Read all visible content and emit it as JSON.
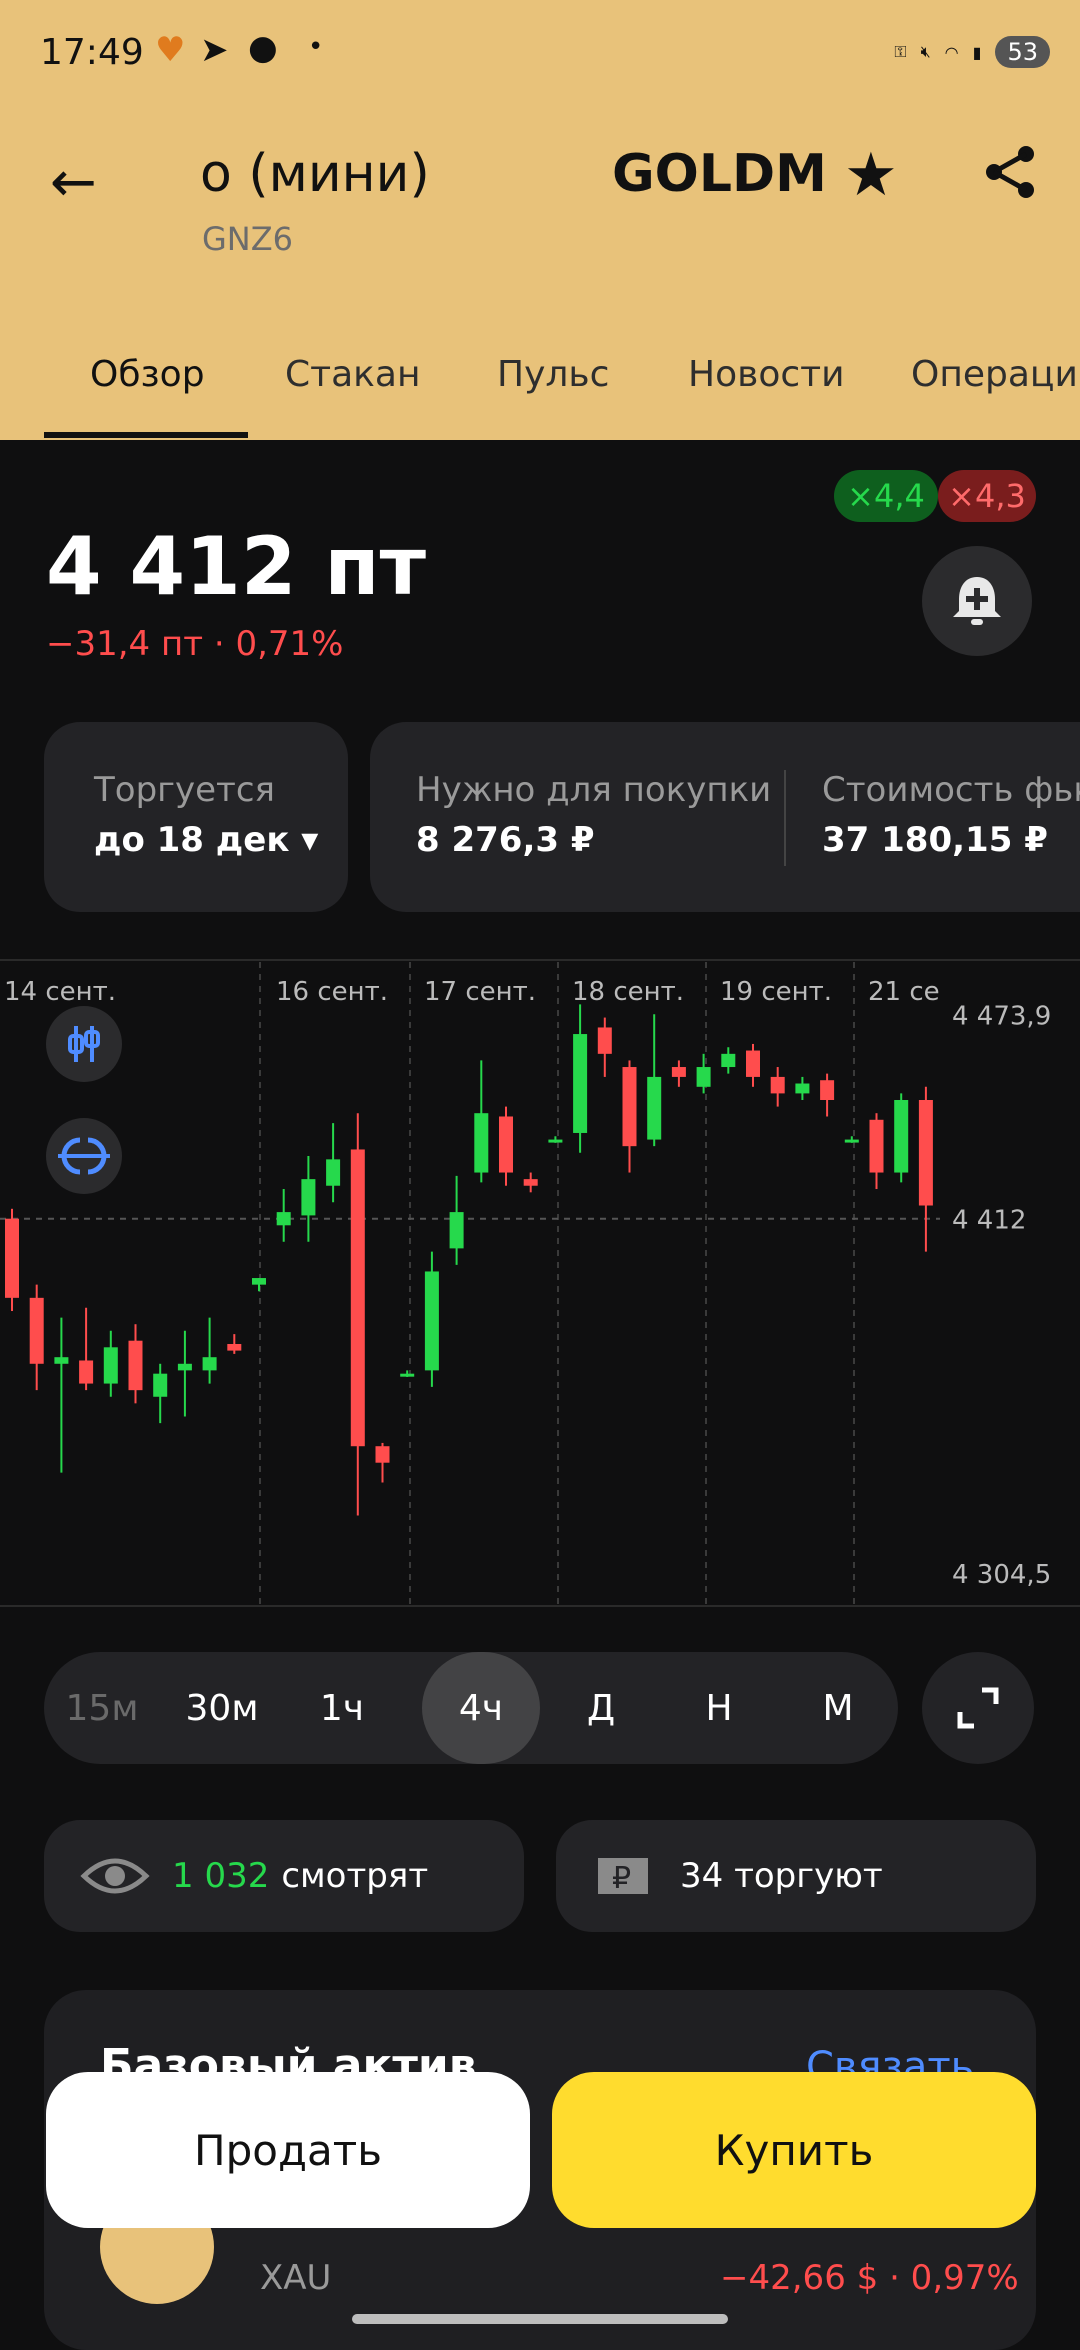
{
  "status": {
    "time": "17:49",
    "battery": "53",
    "signal": "5"
  },
  "header": {
    "title_left": "о (мини)",
    "subtitle": "GNZ6",
    "title_right": "GOLDM"
  },
  "tabs": [
    "Обзор",
    "Стакан",
    "Пульс",
    "Новости",
    "Операции"
  ],
  "leverage": {
    "long": "×4,4",
    "short": "×4,3"
  },
  "price": {
    "value": "4 412 пт",
    "change": "−31,4 пт · 0,71%"
  },
  "info": {
    "trading_label": "Торгуется",
    "trading_value": "до 18 дек ▾",
    "need_label": "Нужно для покупки",
    "need_value": "8 276,3 ₽",
    "cost_label": "Стоимость фьк",
    "cost_value": "37 180,15 ₽"
  },
  "chart_data": {
    "type": "candlestick",
    "x_labels": [
      "14 сент.",
      "16 сент.",
      "17 сент.",
      "18 сент.",
      "19 сент.",
      "21 се"
    ],
    "y_labels": [
      "4 473,9",
      "4 412",
      "4 304,5"
    ],
    "ylim": [
      4300,
      4485
    ],
    "reference_price": 4412,
    "candles": [
      {
        "o": 4412,
        "h": 4415,
        "l": 4384,
        "c": 4388
      },
      {
        "o": 4388,
        "h": 4392,
        "l": 4360,
        "c": 4368
      },
      {
        "o": 4368,
        "h": 4382,
        "l": 4335,
        "c": 4370
      },
      {
        "o": 4369,
        "h": 4385,
        "l": 4360,
        "c": 4362
      },
      {
        "o": 4362,
        "h": 4378,
        "l": 4358,
        "c": 4373
      },
      {
        "o": 4375,
        "h": 4380,
        "l": 4356,
        "c": 4360
      },
      {
        "o": 4358,
        "h": 4368,
        "l": 4350,
        "c": 4365
      },
      {
        "o": 4366,
        "h": 4378,
        "l": 4352,
        "c": 4368
      },
      {
        "o": 4366,
        "h": 4382,
        "l": 4362,
        "c": 4370
      },
      {
        "o": 4374,
        "h": 4377,
        "l": 4371,
        "c": 4372
      },
      {
        "o": 4392,
        "h": 4394,
        "l": 4390,
        "c": 4394
      },
      {
        "o": 4410,
        "h": 4421,
        "l": 4405,
        "c": 4414
      },
      {
        "o": 4413,
        "h": 4431,
        "l": 4405,
        "c": 4424
      },
      {
        "o": 4422,
        "h": 4441,
        "l": 4417,
        "c": 4430
      },
      {
        "o": 4433,
        "h": 4444,
        "l": 4322,
        "c": 4343
      },
      {
        "o": 4343,
        "h": 4344,
        "l": 4332,
        "c": 4338
      },
      {
        "o": 4365,
        "h": 4366,
        "l": 4364,
        "c": 4365
      },
      {
        "o": 4366,
        "h": 4402,
        "l": 4361,
        "c": 4396
      },
      {
        "o": 4403,
        "h": 4425,
        "l": 4398,
        "c": 4414
      },
      {
        "o": 4426,
        "h": 4460,
        "l": 4423,
        "c": 4444
      },
      {
        "o": 4443,
        "h": 4446,
        "l": 4422,
        "c": 4426
      },
      {
        "o": 4424,
        "h": 4426,
        "l": 4420,
        "c": 4422
      },
      {
        "o": 4436,
        "h": 4437,
        "l": 4435,
        "c": 4436
      },
      {
        "o": 4438,
        "h": 4477,
        "l": 4432,
        "c": 4468
      },
      {
        "o": 4470,
        "h": 4473,
        "l": 4455,
        "c": 4462
      },
      {
        "o": 4458,
        "h": 4460,
        "l": 4426,
        "c": 4434
      },
      {
        "o": 4436,
        "h": 4474,
        "l": 4434,
        "c": 4455
      },
      {
        "o": 4458,
        "h": 4460,
        "l": 4452,
        "c": 4455
      },
      {
        "o": 4452,
        "h": 4462,
        "l": 4450,
        "c": 4458
      },
      {
        "o": 4458,
        "h": 4464,
        "l": 4456,
        "c": 4462
      },
      {
        "o": 4463,
        "h": 4465,
        "l": 4452,
        "c": 4455
      },
      {
        "o": 4455,
        "h": 4458,
        "l": 4446,
        "c": 4450
      },
      {
        "o": 4450,
        "h": 4455,
        "l": 4448,
        "c": 4453
      },
      {
        "o": 4454,
        "h": 4456,
        "l": 4443,
        "c": 4448
      },
      {
        "o": 4436,
        "h": 4437,
        "l": 4435,
        "c": 4436
      },
      {
        "o": 4442,
        "h": 4444,
        "l": 4421,
        "c": 4426
      },
      {
        "o": 4426,
        "h": 4450,
        "l": 4423,
        "c": 4448
      },
      {
        "o": 4448,
        "h": 4452,
        "l": 4402,
        "c": 4416
      }
    ]
  },
  "timeframes": [
    "15м",
    "30м",
    "1ч",
    "4ч",
    "Д",
    "Н",
    "М"
  ],
  "timeframe_active": "4ч",
  "viewers": {
    "count": "1 032",
    "label": "смотрят"
  },
  "traders": {
    "label": "34 торгуют"
  },
  "asset": {
    "title": "Базовый актив",
    "link": "Связать",
    "ticker": "XAU",
    "change": "−42,66 $ · 0,97%"
  },
  "actions": {
    "sell": "Продать",
    "buy": "Купить"
  },
  "colors": {
    "header": "#e8c27a",
    "up": "#26d94c",
    "down": "#ff4d4d",
    "buy": "#ffdc2e"
  }
}
